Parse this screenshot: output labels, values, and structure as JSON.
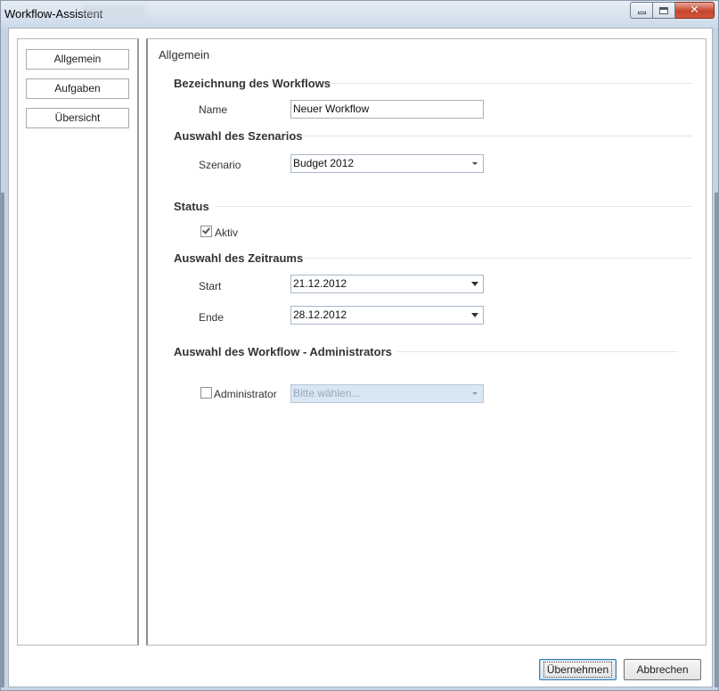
{
  "window": {
    "title": "Workflow-Assistent",
    "close_icon": "close-x-icon",
    "minimize_icon": "minimize-icon",
    "maximize_icon": "maximize-icon"
  },
  "sidebar": {
    "items": [
      {
        "label": "Allgemein"
      },
      {
        "label": "Aufgaben"
      },
      {
        "label": "Übersicht"
      }
    ]
  },
  "panel": {
    "title": "Allgemein",
    "sections": {
      "bezeichnung": "Bezeichnung des Workflows",
      "szenario": "Auswahl des Szenarios",
      "status": "Status",
      "zeitraum": "Auswahl des Zeitraums",
      "admin": "Auswahl des Workflow - Administrators"
    },
    "name": {
      "label": "Name",
      "value": "Neuer Workflow"
    },
    "szenario": {
      "label": "Szenario",
      "value": "Budget 2012"
    },
    "status": {
      "checkbox_label": "Aktiv",
      "checked": true
    },
    "start": {
      "label": "Start",
      "value": "21.12.2012"
    },
    "ende": {
      "label": "Ende",
      "value": "28.12.2012"
    },
    "administrator": {
      "checkbox_label": "Administrator",
      "checked": false,
      "placeholder": "Bitte wählen..."
    }
  },
  "footer": {
    "apply_label": "Übernehmen",
    "cancel_label": "Abbrechen"
  },
  "colors": {
    "accent": "#3c7fb1",
    "disabled_field": "#d9e6f3",
    "close_button": "#c5452e"
  }
}
